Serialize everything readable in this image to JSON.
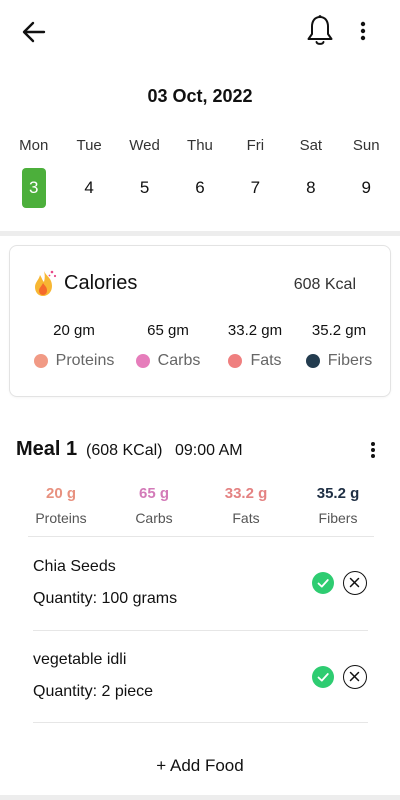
{
  "header": {
    "back_icon": "arrow-left-icon",
    "bell_icon": "bell-icon",
    "menu_icon": "more-vertical-icon"
  },
  "date_title": "03 Oct, 2022",
  "week": [
    {
      "day": "Mon",
      "num": "3",
      "active": true
    },
    {
      "day": "Tue",
      "num": "4",
      "active": false
    },
    {
      "day": "Wed",
      "num": "5",
      "active": false
    },
    {
      "day": "Thu",
      "num": "6",
      "active": false
    },
    {
      "day": "Fri",
      "num": "7",
      "active": false
    },
    {
      "day": "Sat",
      "num": "8",
      "active": false
    },
    {
      "day": "Sun",
      "num": "9",
      "active": false
    }
  ],
  "calories": {
    "icon": "fire-icon",
    "title": "Calories",
    "total": "608 Kcal",
    "macros": [
      {
        "value": "20 gm",
        "label": "Proteins",
        "color": "#f19a85"
      },
      {
        "value": "65 gm",
        "label": "Carbs",
        "color": "#e67dbb"
      },
      {
        "value": "33.2 gm",
        "label": "Fats",
        "color": "#ef7f7f"
      },
      {
        "value": "35.2 gm",
        "label": "Fibers",
        "color": "#233c4f"
      }
    ]
  },
  "meal": {
    "title": "Meal 1",
    "kcal": "(608 KCal)",
    "time": "09:00 AM",
    "menu_icon": "more-vertical-icon",
    "macros": [
      {
        "value": "20 g",
        "label": "Proteins",
        "color": "#e8917f"
      },
      {
        "value": "65 g",
        "label": "Carbs",
        "color": "#d37ab8"
      },
      {
        "value": "33.2 g",
        "label": "Fats",
        "color": "#e48282"
      },
      {
        "value": "35.2 g",
        "label": "Fibers",
        "color": "#1f2f44"
      }
    ],
    "foods": [
      {
        "name": "Chia Seeds",
        "quantity": "Quantity: 100 grams"
      },
      {
        "name": "vegetable idli",
        "quantity": "Quantity: 2 piece"
      }
    ],
    "add_food_label": "+ Add Food"
  },
  "colors": {
    "accent_green": "#4caf3b",
    "check_green": "#2ecc71"
  }
}
